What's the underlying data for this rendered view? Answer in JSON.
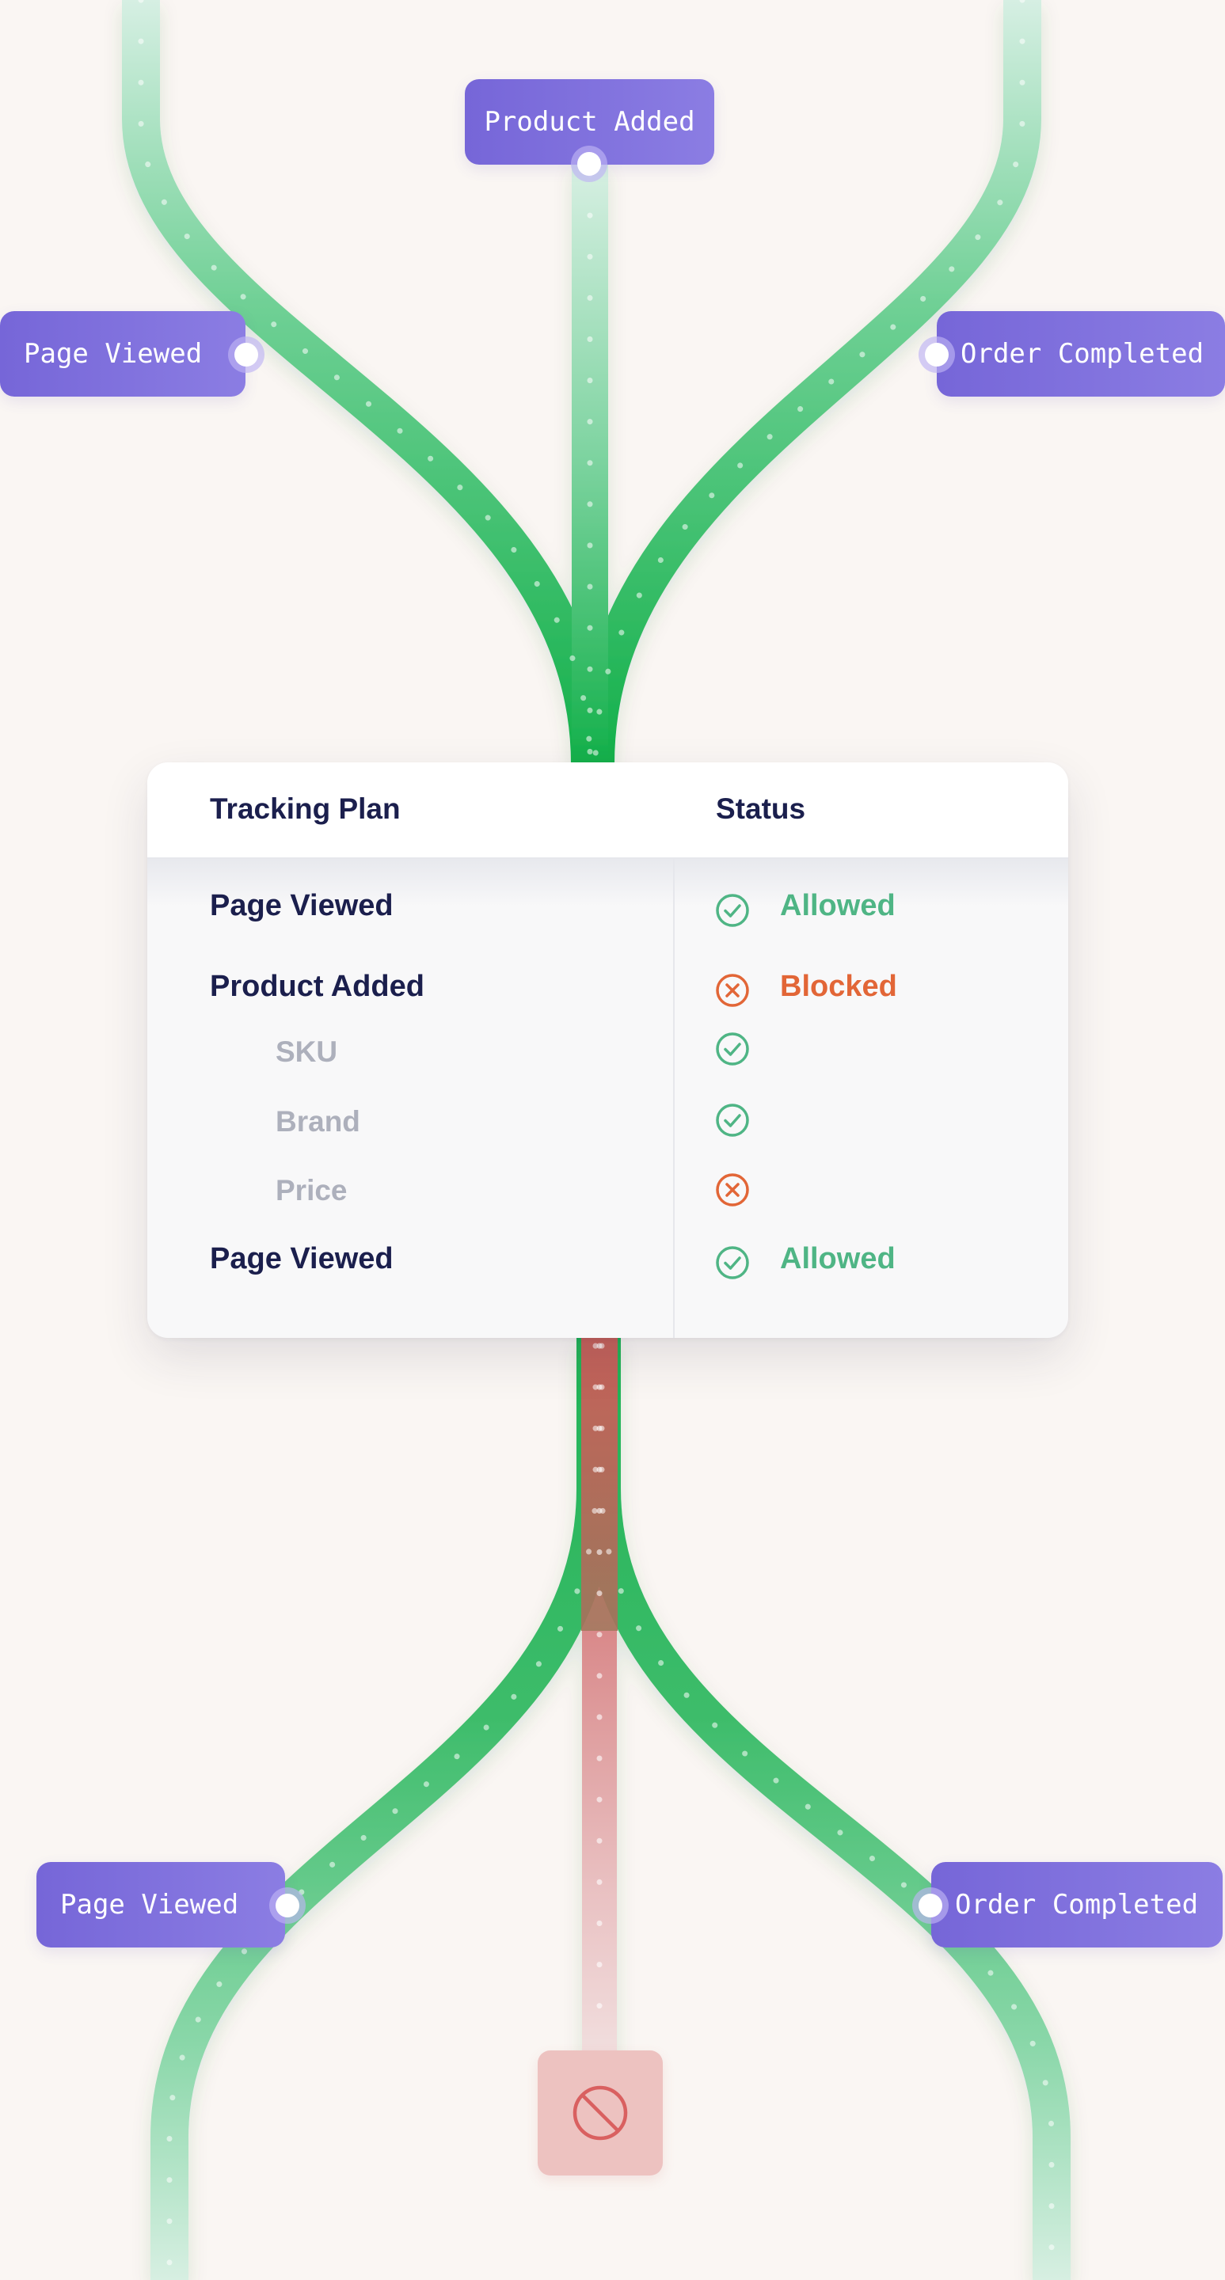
{
  "events": {
    "product_added": "Product Added",
    "page_viewed_top": "Page Viewed",
    "order_completed_top": "Order Completed",
    "page_viewed_bottom": "Page Viewed",
    "order_completed_bottom": "Order Completed"
  },
  "table": {
    "header_plan": "Tracking Plan",
    "header_status": "Status",
    "rows": [
      {
        "label": "Page Viewed",
        "status": "Allowed",
        "state": "allowed",
        "level": "event"
      },
      {
        "label": "Product Added",
        "status": "Blocked",
        "state": "blocked",
        "level": "event"
      },
      {
        "label": "SKU",
        "status": "",
        "state": "allowed",
        "level": "property"
      },
      {
        "label": "Brand",
        "status": "",
        "state": "allowed",
        "level": "property"
      },
      {
        "label": "Price",
        "status": "",
        "state": "blocked",
        "level": "property"
      },
      {
        "label": "Page Viewed",
        "status": "Allowed",
        "state": "allowed",
        "level": "event"
      }
    ]
  },
  "blocked_node": {
    "icon": "prohibited-icon"
  },
  "colors": {
    "background": "#faf6f3",
    "event_chip": "#7a6ad9",
    "allowed_green": "#4fb585",
    "blocked_orange": "#e26637",
    "flow_green": "#1fb356",
    "flow_red": "#d45a5a",
    "header_text": "#1b1f4d",
    "property_text": "#adb0bc"
  }
}
